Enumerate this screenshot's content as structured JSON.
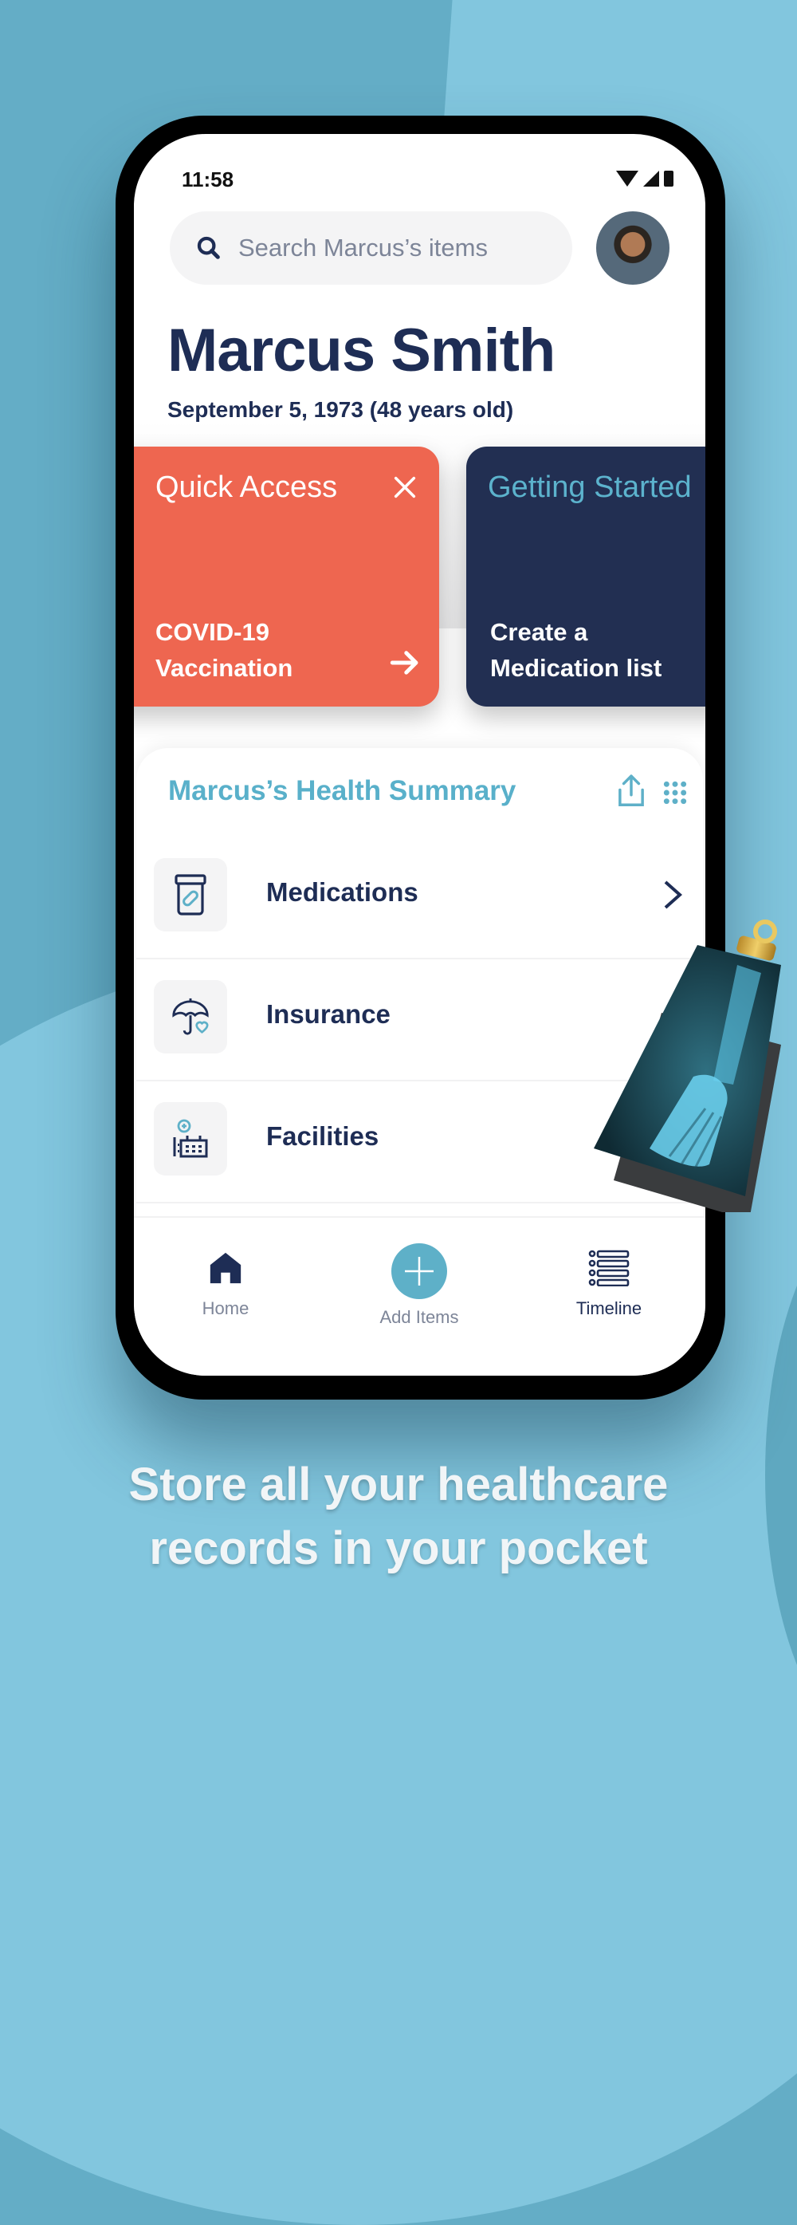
{
  "status_bar": {
    "time": "11:58",
    "icons": [
      "wifi-icon",
      "signal-icon",
      "battery-icon"
    ]
  },
  "search": {
    "placeholder": "Search Marcus’s items",
    "value": ""
  },
  "profile": {
    "name": "Marcus Smith",
    "dob": "September 5, 1973 (48 years old)"
  },
  "cards": [
    {
      "title": "Quick Access",
      "body_line1": "COVID-19",
      "body_line2": "Vaccination",
      "color": "#EE6650"
    },
    {
      "title": "Getting Started",
      "body_line1": "Create a",
      "body_line2": "Medication list",
      "color": "#222F52"
    }
  ],
  "summary": {
    "title": "Marcus’s Health Summary",
    "items": [
      {
        "label": "Medications",
        "icon": "medication-bottle-icon"
      },
      {
        "label": "Insurance",
        "icon": "umbrella-heart-icon"
      },
      {
        "label": "Facilities",
        "icon": "hospital-building-icon"
      }
    ]
  },
  "nav": [
    {
      "label": "Home",
      "icon": "home-icon"
    },
    {
      "label": "Add Items",
      "icon": "plus-icon"
    },
    {
      "label": "Timeline",
      "icon": "timeline-list-icon"
    }
  ],
  "caption": {
    "line1": "Store all your healthcare",
    "line2": "records in your pocket"
  },
  "colors": {
    "primary_navy": "#1E2D55",
    "accent_teal": "#5EB0C8",
    "coral": "#EE6650",
    "background": "#64ADC6"
  }
}
